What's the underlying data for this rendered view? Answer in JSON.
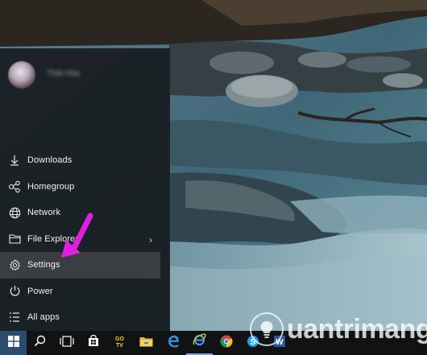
{
  "user": {
    "name": "Thái Hòa"
  },
  "start_menu": {
    "items": [
      {
        "label": "Downloads",
        "icon": "download-icon"
      },
      {
        "label": "Homegroup",
        "icon": "homegroup-icon"
      },
      {
        "label": "Network",
        "icon": "network-icon"
      },
      {
        "label": "File Explorer",
        "icon": "folder-icon",
        "has_submenu": true
      },
      {
        "label": "Settings",
        "icon": "gear-icon",
        "selected": true
      },
      {
        "label": "Power",
        "icon": "power-icon"
      },
      {
        "label": "All apps",
        "icon": "list-icon"
      }
    ]
  },
  "taskbar": {
    "icons": [
      "windows-icon",
      "search-icon",
      "task-view-icon",
      "store-icon",
      "gotv-icon",
      "file-explorer-icon",
      "edge-icon",
      "internet-explorer-icon",
      "chrome-icon",
      "skype-icon",
      "word-icon"
    ],
    "gotv_label": "GO TV"
  },
  "watermark": {
    "text": "uantrimang"
  },
  "colors": {
    "accent_arrow": "#e020e0",
    "menu_bg": "#181c1e",
    "taskbar_bg": "#101214",
    "start_button_bg": "#2b4c6c"
  }
}
